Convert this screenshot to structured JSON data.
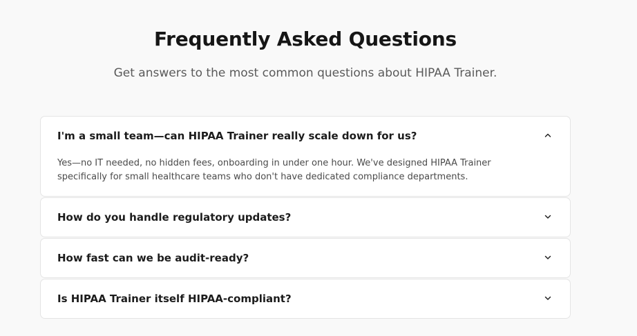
{
  "header": {
    "title": "Frequently Asked Questions",
    "subtitle": "Get answers to the most common questions about HIPAA Trainer."
  },
  "faq": {
    "items": [
      {
        "question": "I'm a small team—can HIPAA Trainer really scale down for us?",
        "answer": "Yes—no IT needed, no hidden fees, onboarding in under one hour. We've designed HIPAA Trainer specifically for small healthcare teams who don't have dedicated compliance departments.",
        "expanded": true,
        "icon": "chevron-up-icon"
      },
      {
        "question": "How do you handle regulatory updates?",
        "expanded": false,
        "icon": "chevron-down-icon"
      },
      {
        "question": "How fast can we be audit-ready?",
        "expanded": false,
        "icon": "chevron-down-icon"
      },
      {
        "question": "Is HIPAA Trainer itself HIPAA-compliant?",
        "expanded": false,
        "icon": "chevron-down-icon"
      }
    ]
  },
  "colors": {
    "background": "#f9f9f9",
    "card": "#ffffff",
    "border": "#e4e4e4",
    "heading": "#161616",
    "muted": "#5a5a5a"
  }
}
